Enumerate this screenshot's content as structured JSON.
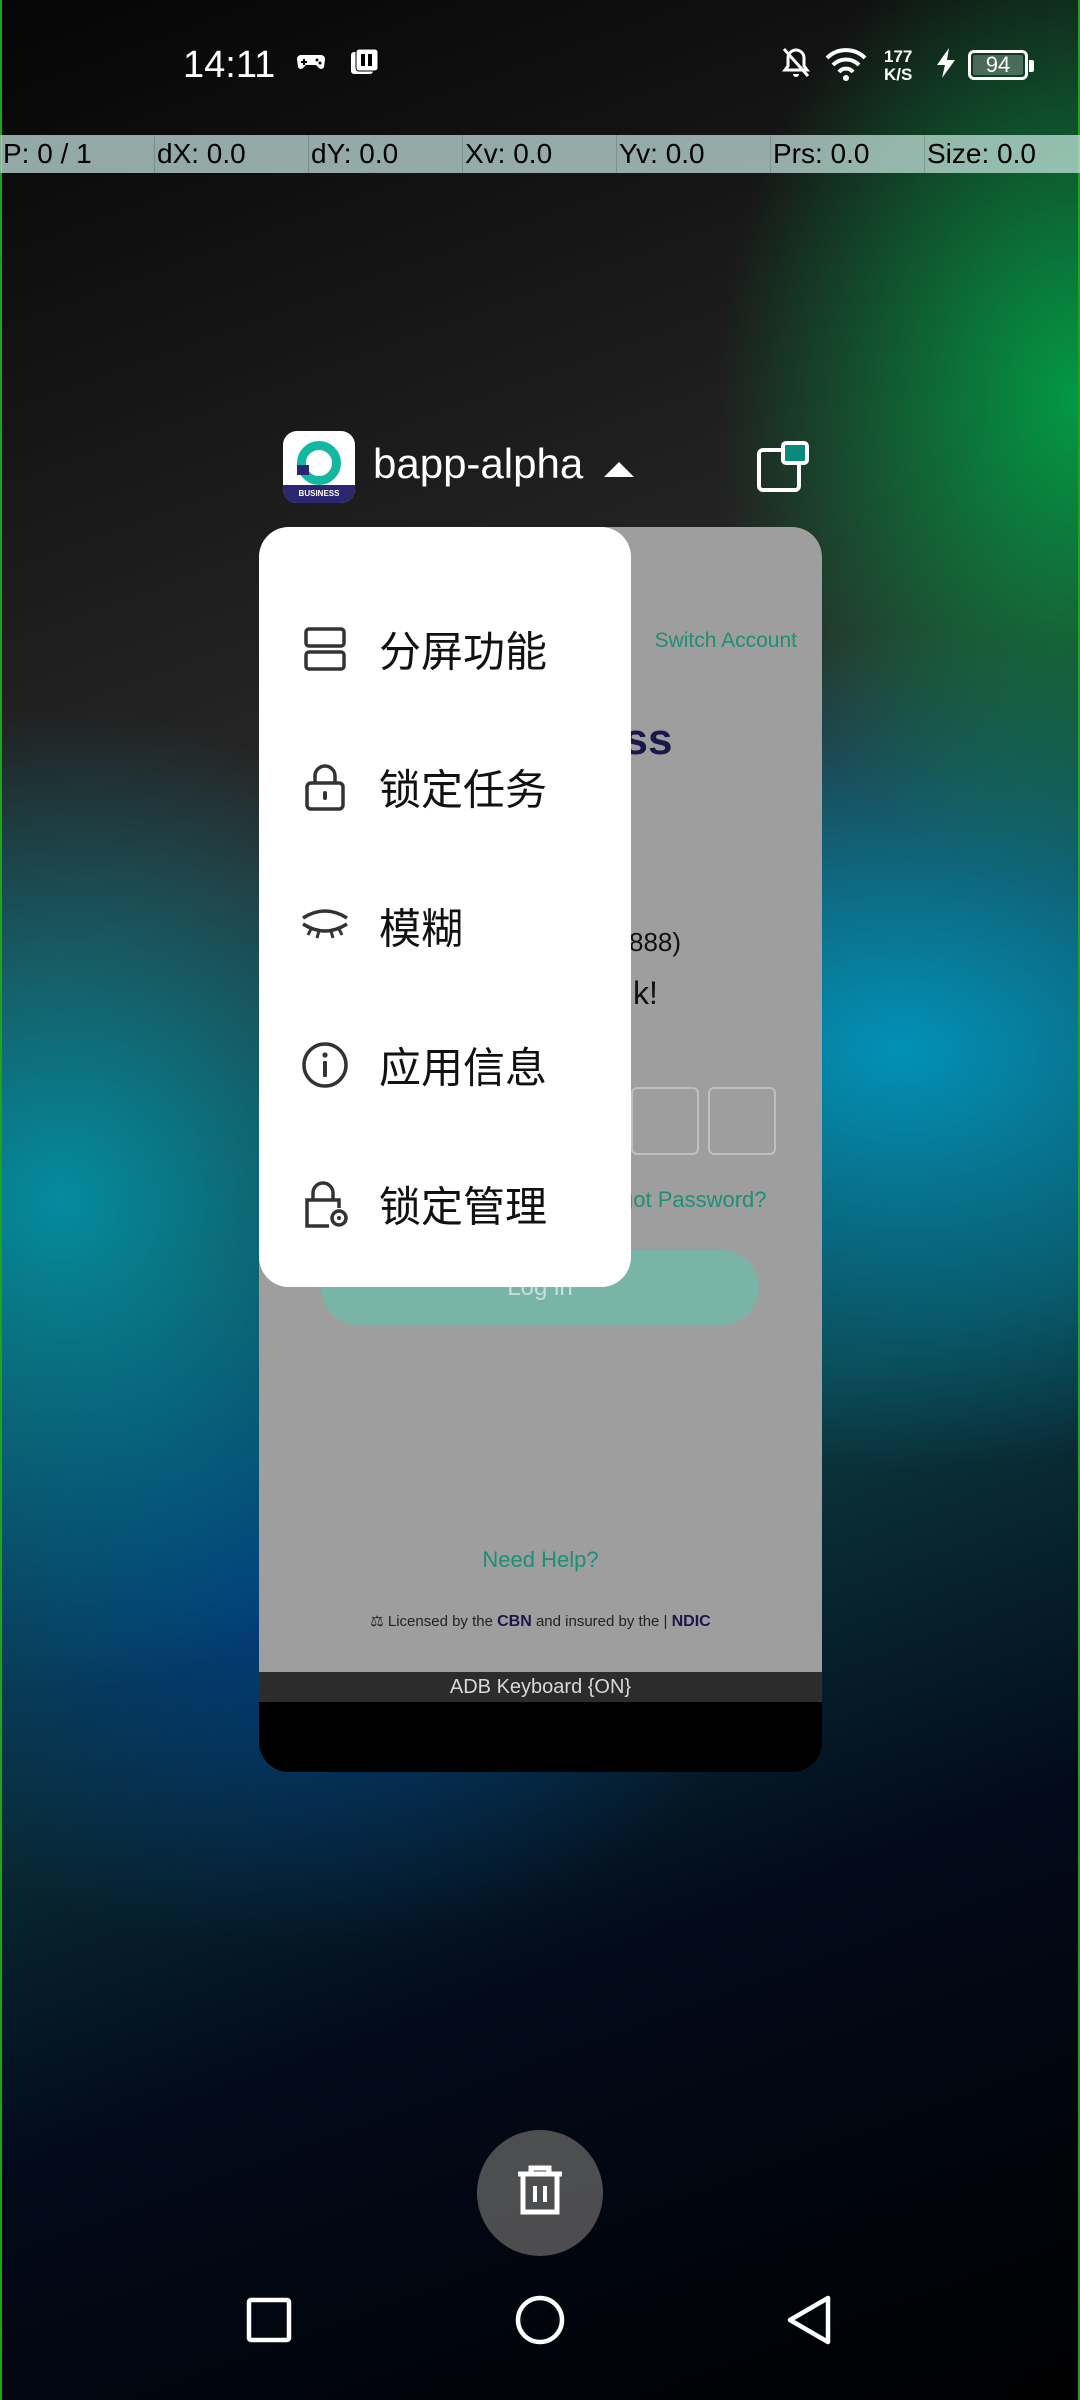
{
  "status_bar": {
    "time": "14:11",
    "net_speed_value": "177",
    "net_speed_unit": "K/S",
    "battery": "94"
  },
  "pointer_bar": [
    "P: 0 / 1",
    "dX: 0.0",
    "dY: 0.0",
    "Xv: 0.0",
    "Yv: 0.0",
    "Prs: 0.0",
    "Size: 0.0"
  ],
  "recent_app": {
    "name": "bapp-alpha",
    "icon_badge": "BUSINESS"
  },
  "app_preview": {
    "switch_account": "Switch Account",
    "heading_fragment": "ess",
    "number_fragment": "888)",
    "welcome_fragment": "k!",
    "forgot_password": "got Password?",
    "login_button": "Log in",
    "need_help": "Need Help?",
    "licensed_pre": "Licensed by the",
    "licensed_cbn": "CBN",
    "licensed_mid": "and insured by the |",
    "licensed_ndic": "NDIC",
    "keyboard_status": "ADB Keyboard {ON}"
  },
  "menu": {
    "items": [
      {
        "label": "分屏功能",
        "icon": "split-screen-icon"
      },
      {
        "label": "锁定任务",
        "icon": "lock-icon"
      },
      {
        "label": "模糊",
        "icon": "closed-eye-icon"
      },
      {
        "label": "应用信息",
        "icon": "info-icon"
      },
      {
        "label": "锁定管理",
        "icon": "lock-settings-icon"
      }
    ]
  },
  "colors": {
    "accent": "#1d8f74",
    "brand_dark": "#1b174a"
  }
}
